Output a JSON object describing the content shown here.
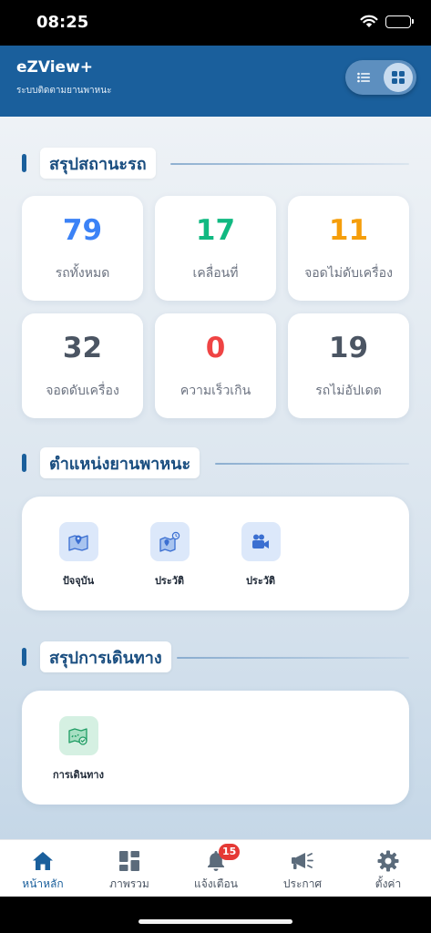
{
  "status_bar": {
    "time": "08:25"
  },
  "header": {
    "title": "eZView+",
    "subtitle": "ระบบติดตามยานพาหนะ"
  },
  "status_section": {
    "title": "สรุปสถานะรถ",
    "cards": [
      {
        "value": "79",
        "label": "รถทั้งหมด",
        "color": "#3b82f6"
      },
      {
        "value": "17",
        "label": "เคลื่อนที่",
        "color": "#10b981"
      },
      {
        "value": "11",
        "label": "จอดไม่ดับเครื่อง",
        "color": "#f59e0b"
      },
      {
        "value": "32",
        "label": "จอดดับเครื่อง",
        "color": "#4b5563"
      },
      {
        "value": "0",
        "label": "ความเร็วเกิน",
        "color": "#ef4444"
      },
      {
        "value": "19",
        "label": "รถไม่อัปเดต",
        "color": "#4b5563"
      }
    ]
  },
  "location_section": {
    "title": "ตำแหน่งยานพาหนะ",
    "items": [
      {
        "label": "ปัจจุบัน",
        "icon": "map-pin-icon"
      },
      {
        "label": "ประวัติ",
        "icon": "map-history-icon"
      },
      {
        "label": "ประวัติ",
        "icon": "video-camera-icon"
      }
    ]
  },
  "trip_section": {
    "title": "สรุปการเดินทาง",
    "items": [
      {
        "label": "การเดินทาง",
        "icon": "route-map-icon"
      }
    ]
  },
  "bottom_nav": {
    "items": [
      {
        "label": "หน้าหลัก",
        "icon": "home-icon",
        "active": true
      },
      {
        "label": "ภาพรวม",
        "icon": "dashboard-icon"
      },
      {
        "label": "แจ้งเตือน",
        "icon": "bell-icon",
        "badge": "15"
      },
      {
        "label": "ประกาศ",
        "icon": "megaphone-icon"
      },
      {
        "label": "ตั้งค่า",
        "icon": "gear-icon"
      }
    ]
  },
  "colors": {
    "primary": "#1a5f9c",
    "badge": "#e53935"
  }
}
